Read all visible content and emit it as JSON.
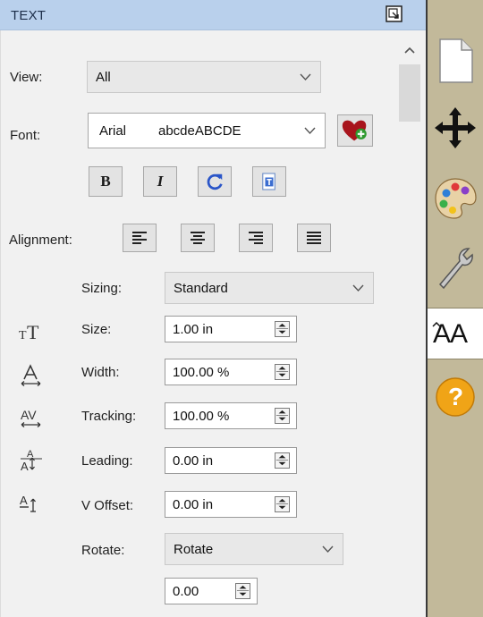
{
  "header": {
    "title": "TEXT"
  },
  "view": {
    "label": "View:",
    "value": "All"
  },
  "font": {
    "label": "Font:",
    "name": "Arial",
    "sample": "abcdeABCDE"
  },
  "style_buttons": {
    "bold": "B",
    "italic": "I"
  },
  "alignment": {
    "label": "Alignment:"
  },
  "sizing": {
    "label": "Sizing:",
    "value": "Standard"
  },
  "size": {
    "label": "Size:",
    "value": "1.00 in"
  },
  "width": {
    "label": "Width:",
    "value": "100.00 %"
  },
  "tracking": {
    "label": "Tracking:",
    "value": "100.00 %"
  },
  "leading": {
    "label": "Leading:",
    "value": "0.00 in"
  },
  "v_offset": {
    "label": "V Offset:",
    "value": "0.00 in"
  },
  "rotate": {
    "label": "Rotate:",
    "value": "Rotate",
    "angle": "0.00"
  },
  "sidebar": {
    "text_tab_label": "AA",
    "help_label": "?"
  },
  "colors": {
    "header": "#b9d0ec",
    "panel": "#f1f1f1",
    "sidebar": "#c2b99a",
    "help": "#f0a417"
  }
}
